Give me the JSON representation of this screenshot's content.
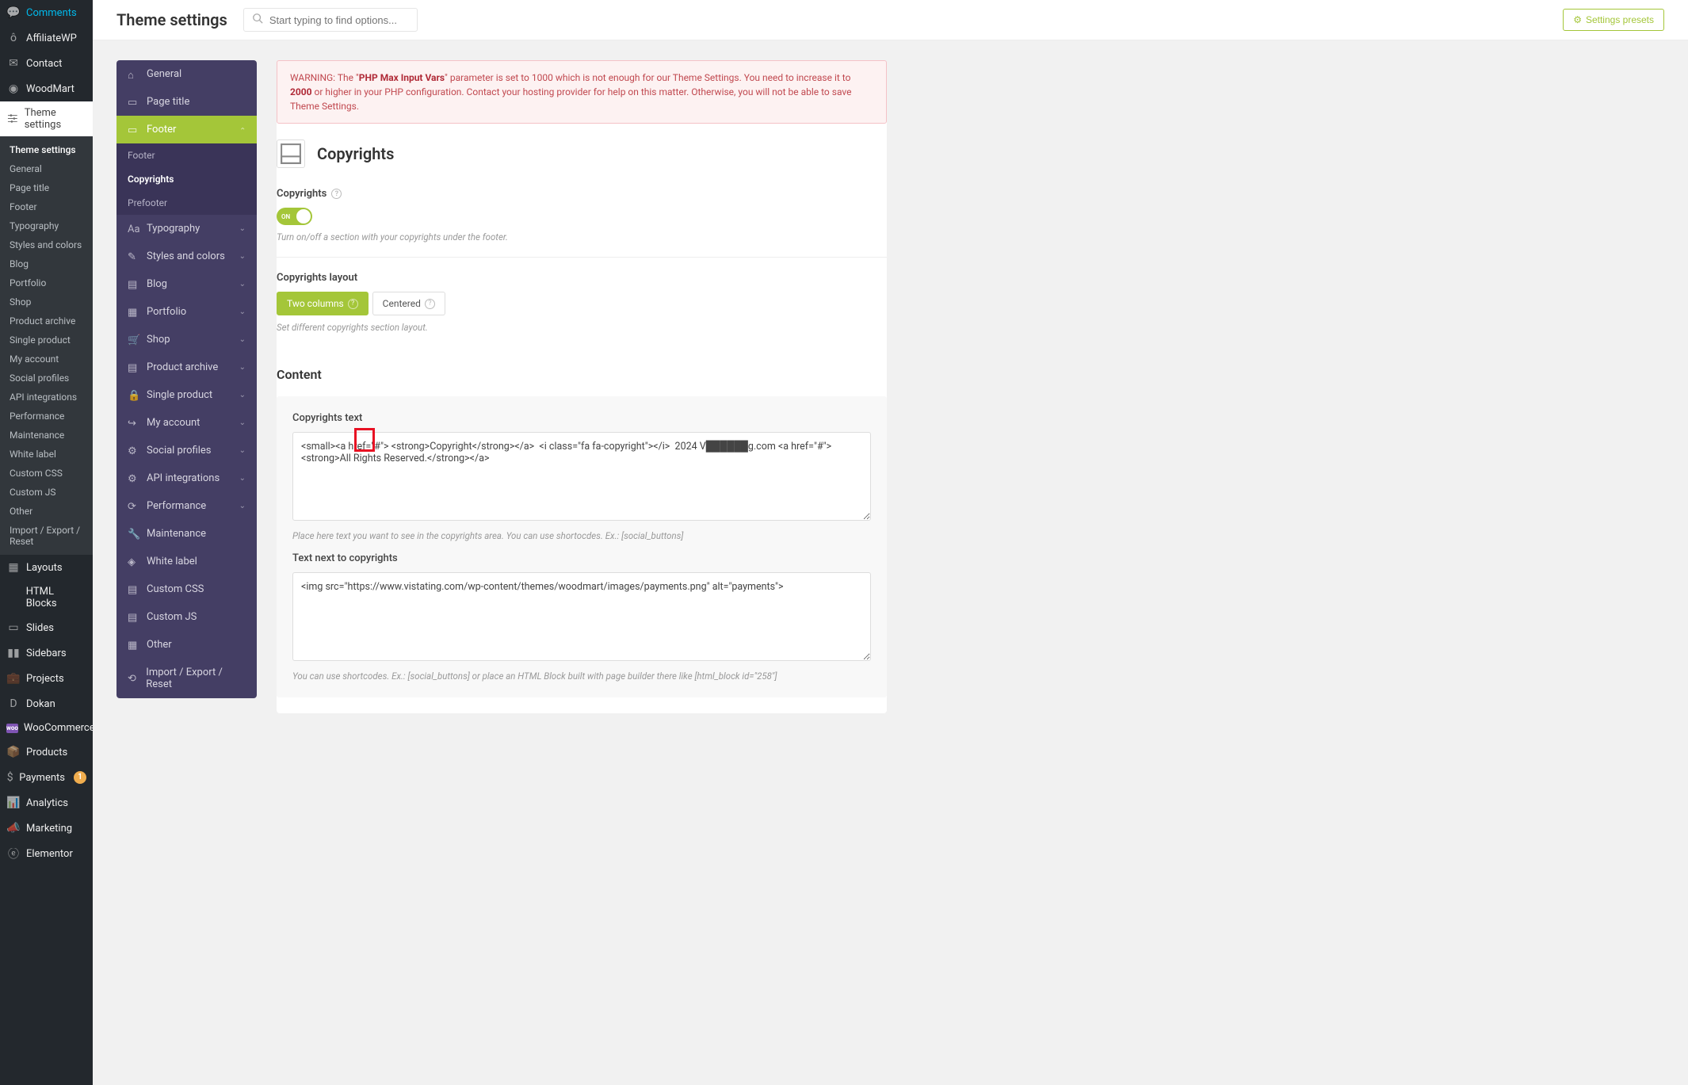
{
  "wp_menu": {
    "items_top": [
      {
        "label": "Comments",
        "ico": "comment"
      },
      {
        "label": "AffiliateWP",
        "ico": "affiliate"
      },
      {
        "label": "Contact",
        "ico": "envelope"
      }
    ],
    "woodmart": "WoodMart",
    "theme_settings": "Theme settings",
    "sub_items": [
      "Theme settings",
      "General",
      "Page title",
      "Footer",
      "Typography",
      "Styles and colors",
      "Blog",
      "Portfolio",
      "Shop",
      "Product archive",
      "Single product",
      "My account",
      "Social profiles",
      "API integrations",
      "Performance",
      "Maintenance",
      "White label",
      "Custom CSS",
      "Custom JS",
      "Other",
      "Import / Export / Reset"
    ],
    "items_bottom": [
      {
        "label": "Layouts",
        "ico": "layouts"
      },
      {
        "label": "HTML Blocks",
        "ico": "html"
      },
      {
        "label": "Slides",
        "ico": "slides"
      },
      {
        "label": "Sidebars",
        "ico": "sidebars"
      },
      {
        "label": "Projects",
        "ico": "projects"
      },
      {
        "label": "Dokan",
        "ico": "dokan"
      },
      {
        "label": "WooCommerce",
        "ico": "woo",
        "is_woo": true
      },
      {
        "label": "Products",
        "ico": "products"
      },
      {
        "label": "Payments",
        "ico": "payments",
        "badge": "1"
      },
      {
        "label": "Analytics",
        "ico": "analytics"
      },
      {
        "label": "Marketing",
        "ico": "marketing"
      },
      {
        "label": "Elementor",
        "ico": "elementor"
      }
    ]
  },
  "topbar": {
    "title": "Theme settings",
    "search_placeholder": "Start typing to find options...",
    "preset_label": "Settings presets"
  },
  "tabs": [
    {
      "label": "General",
      "ico": "home"
    },
    {
      "label": "Page title",
      "ico": "page"
    },
    {
      "label": "Footer",
      "ico": "footer",
      "open": true,
      "sub": [
        {
          "label": "Footer"
        },
        {
          "label": "Copyrights",
          "active": true
        },
        {
          "label": "Prefooter"
        }
      ]
    },
    {
      "label": "Typography",
      "ico": "typo",
      "chev": true
    },
    {
      "label": "Styles and colors",
      "ico": "palette",
      "chev": true
    },
    {
      "label": "Blog",
      "ico": "blog",
      "chev": true
    },
    {
      "label": "Portfolio",
      "ico": "portfolio",
      "chev": true
    },
    {
      "label": "Shop",
      "ico": "shop",
      "chev": true
    },
    {
      "label": "Product archive",
      "ico": "archive",
      "chev": true
    },
    {
      "label": "Single product",
      "ico": "lock",
      "chev": true
    },
    {
      "label": "My account",
      "ico": "account",
      "chev": true
    },
    {
      "label": "Social profiles",
      "ico": "social",
      "chev": true
    },
    {
      "label": "API integrations",
      "ico": "api",
      "chev": true
    },
    {
      "label": "Performance",
      "ico": "perf",
      "chev": true
    },
    {
      "label": "Maintenance",
      "ico": "wrench"
    },
    {
      "label": "White label",
      "ico": "tag"
    },
    {
      "label": "Custom CSS",
      "ico": "css"
    },
    {
      "label": "Custom JS",
      "ico": "js"
    },
    {
      "label": "Other",
      "ico": "other"
    },
    {
      "label": "Import / Export / Reset",
      "ico": "import"
    }
  ],
  "warning": {
    "text1": "WARNING: The \"",
    "strong1": "PHP Max Input Vars",
    "text2": "\" parameter is set to 1000 which is not enough for our Theme Settings. You need to increase it to ",
    "strong2": "2000",
    "text3": " or higher in your PHP configuration. Contact your hosting provider for help on this matter. Otherwise, you will not be able to save Theme Settings."
  },
  "page": {
    "heading": "Copyrights",
    "copyright_label": "Copyrights",
    "toggle_on": "ON",
    "toggle_help": "Turn on/off a section with your copyrights under the footer.",
    "layout_label": "Copyrights layout",
    "opt_two_columns": "Two columns",
    "opt_centered": "Centered",
    "layout_help": "Set different copyrights section layout.",
    "content_heading": "Content",
    "copyrights_text_label": "Copyrights text",
    "copyrights_text_value": "<small><a href=\"#\"> <strong>Copyright</strong></a>  <i class=\"fa fa-copyright\"></i>  2024 V██████g.com <a href=\"#\"><strong>All Rights Reserved.</strong></a>",
    "copyrights_text_help": "Place here text you want to see in the copyrights area. You can use shortocdes. Ex.: [social_buttons]",
    "text_next_label": "Text next to copyrights",
    "text_next_value": "<img src=\"https://www.vistating.com/wp-content/themes/woodmart/images/payments.png\" alt=\"payments\">",
    "text_next_help": "You can use shortcodes. Ex.: [social_buttons] or place an HTML Block built with page builder there like [html_block id=\"258\"]"
  }
}
